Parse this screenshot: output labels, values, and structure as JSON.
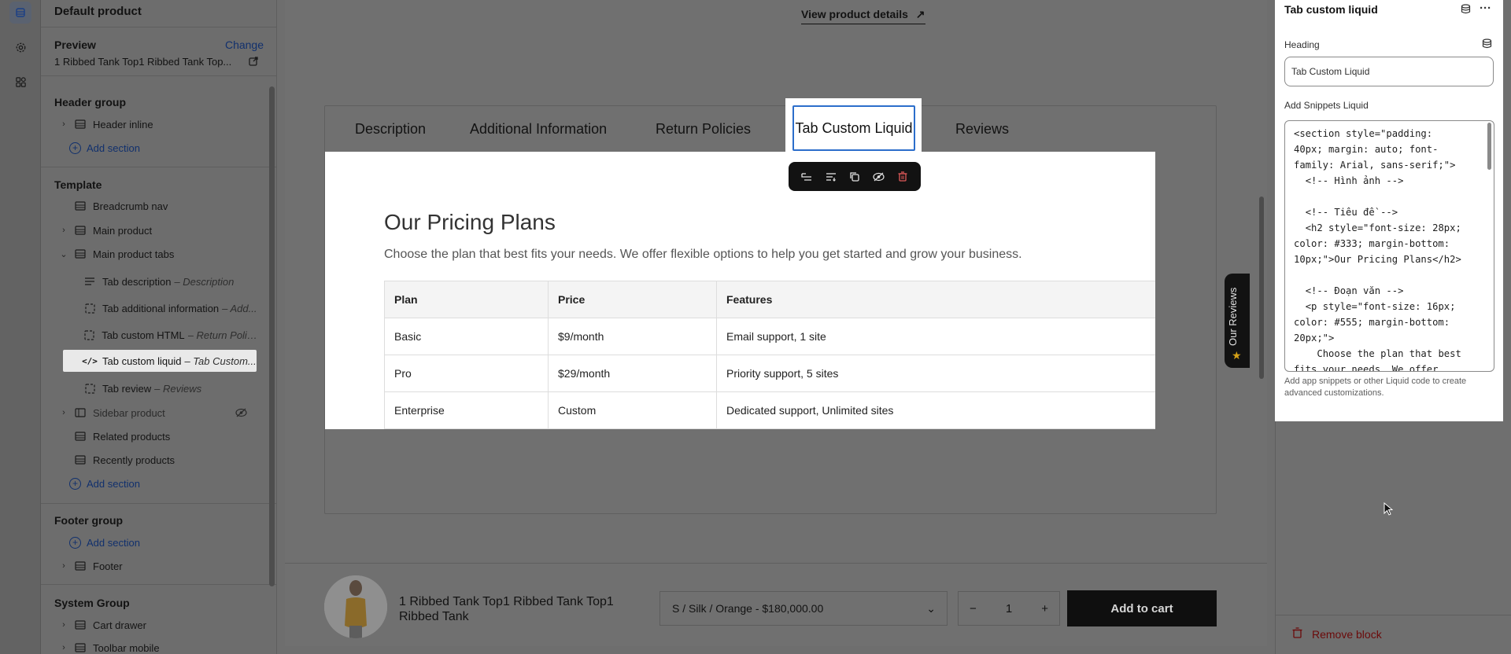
{
  "sidebar": {
    "product_title": "Default product",
    "preview_label": "Preview",
    "change_link": "Change",
    "preview_value": "1 Ribbed Tank Top1 Ribbed Tank Top...",
    "header_group": "Header group",
    "header_inline": "Header inline",
    "add_section": "Add section",
    "template": "Template",
    "items": [
      {
        "label": "Breadcrumb nav",
        "sub": ""
      },
      {
        "label": "Main product",
        "sub": ""
      },
      {
        "label": "Main product tabs",
        "sub": ""
      },
      {
        "label": "Tab description",
        "sub": "– Description"
      },
      {
        "label": "Tab additional information",
        "sub": "– Add..."
      },
      {
        "label": "Tab custom HTML",
        "sub": "– Return Polic..."
      },
      {
        "label": "Tab custom liquid",
        "sub": "– Tab Custom..."
      },
      {
        "label": "Tab review",
        "sub": "– Reviews"
      },
      {
        "label": "Sidebar product",
        "sub": ""
      },
      {
        "label": "Related products",
        "sub": ""
      },
      {
        "label": "Recently products",
        "sub": ""
      }
    ],
    "footer_group": "Footer group",
    "footer": "Footer",
    "system_group": "System Group",
    "cart_drawer": "Cart drawer",
    "toolbar_mobile": "Toolbar mobile"
  },
  "canvas": {
    "view_details": "View product details",
    "tabs": [
      "Description",
      "Additional Information",
      "Return Policies",
      "Tab Custom Liquid",
      "Reviews"
    ],
    "heading": "Our Pricing Plans",
    "intro": "Choose the plan that best fits your needs. We offer flexible options to help you get started and grow your business.",
    "table": {
      "headers": [
        "Plan",
        "Price",
        "Features"
      ],
      "rows": [
        [
          "Basic",
          "$9/month",
          "Email support, 1 site"
        ],
        [
          "Pro",
          "$29/month",
          "Priority support, 5 sites"
        ],
        [
          "Enterprise",
          "Custom",
          "Dedicated support, Unlimited sites"
        ]
      ]
    },
    "reviews_tab": "Our Reviews",
    "sticky": {
      "product_name": "1 Ribbed Tank Top1 Ribbed Tank Top1 Ribbed Tank",
      "variant": "S / Silk / Orange - $180,000.00",
      "quantity": "1",
      "add_to_cart": "Add to cart"
    }
  },
  "panel": {
    "title": "Tab custom liquid",
    "heading_label": "Heading",
    "heading_value": "Tab Custom Liquid",
    "snippets_label": "Add Snippets Liquid",
    "code": "<section style=\"padding:\n40px; margin: auto; font-\nfamily: Arial, sans-serif;\">\n  <!-- Hình ảnh -->\n\n  <!-- Tiêu đề -->\n  <h2 style=\"font-size: 28px;\ncolor: #333; margin-bottom:\n10px;\">Our Pricing Plans</h2>\n\n  <!-- Đoạn văn -->\n  <p style=\"font-size: 16px;\ncolor: #555; margin-bottom:\n20px;\">\n    Choose the plan that best\nfits your needs. We offer",
    "help": "Add app snippets or other Liquid code to create advanced customizations.",
    "remove": "Remove block"
  }
}
